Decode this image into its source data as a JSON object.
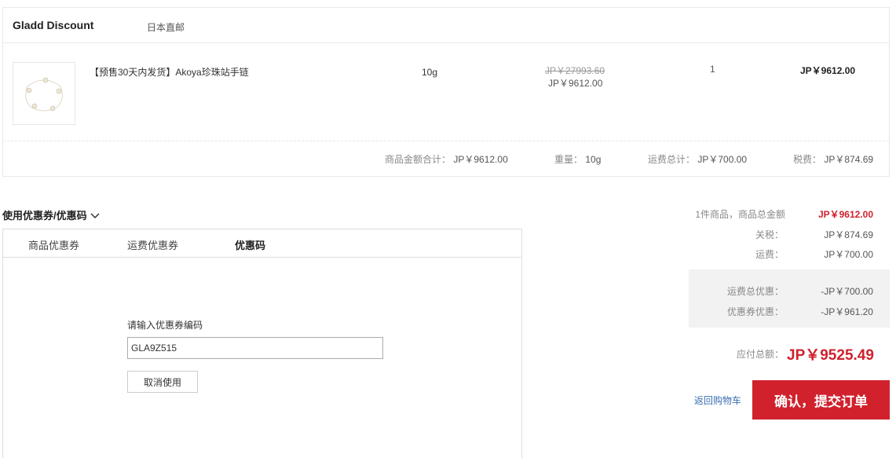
{
  "shop": {
    "name": "Gladd Discount",
    "tag": "日本直邮"
  },
  "product": {
    "name": "【预售30天内发货】Akoya珍珠站手链",
    "weight": "10g",
    "original_price": "JP￥27993.60",
    "price": "JP￥9612.00",
    "quantity": "1",
    "total": "JP￥9612.00"
  },
  "summary": {
    "goods_label": "商品金额合计：",
    "goods_value": "JP￥9612.00",
    "weight_label": "重量：",
    "weight_value": "10g",
    "shipping_label": "运费总计：",
    "shipping_value": "JP￥700.00",
    "tax_label": "税费：",
    "tax_value": "JP￥874.69"
  },
  "coupon": {
    "title": "使用优惠券/优惠码",
    "tabs": [
      "商品优惠券",
      "运费优惠券",
      "优惠码"
    ],
    "active_tab": "优惠码",
    "code_label": "请输入优惠券编码",
    "code_value": "GLA9Z515",
    "cancel_label": "取消使用"
  },
  "totals": {
    "items_label": "1件商品，商品总金额",
    "items_value": "JP￥9612.00",
    "duty_label": "关税：",
    "duty_value": "JP￥874.69",
    "freight_label": "运费：",
    "freight_value": "JP￥700.00",
    "freight_discount_label": "运费总优惠：",
    "freight_discount_value": "-JP￥700.00",
    "coupon_discount_label": "优惠券优惠：",
    "coupon_discount_value": "-JP￥961.20",
    "payable_label": "应付总额：",
    "payable_value": "JP￥9525.49"
  },
  "actions": {
    "back_label": "返回购物车",
    "submit_label": "确认，提交订单"
  },
  "colors": {
    "accent": "#d0212d",
    "link": "#3a6fb0"
  }
}
